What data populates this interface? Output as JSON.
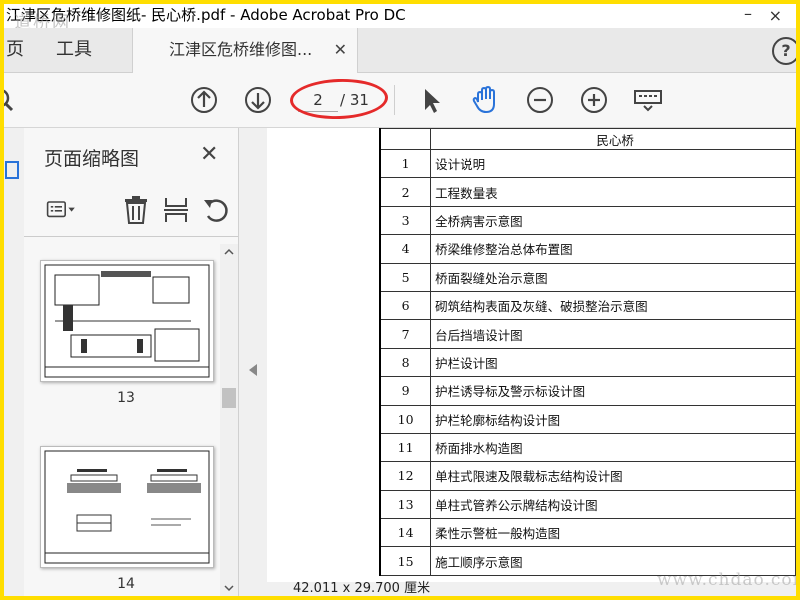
{
  "window": {
    "title": "江津区危桥维修图纸- 民心桥.pdf - Adobe Acrobat Pro DC",
    "watermark_top": "道桥网",
    "close_symbol": "×",
    "min_symbol": "–"
  },
  "tabs": {
    "home_partial": "页",
    "tools": "工具",
    "document": "江津区危桥维修图...",
    "close_symbol": "✕",
    "help_symbol": "?"
  },
  "toolbar": {
    "current_page": "2",
    "total_pages": "/ 31",
    "icons": [
      "search-icon",
      "arrow-up-circle-icon",
      "arrow-down-circle-icon",
      "select-arrow-icon",
      "hand-icon",
      "zoom-out-icon",
      "zoom-in-icon",
      "keyboard-icon"
    ],
    "hand_color": "#2a73d9"
  },
  "sidebar": {
    "title": "页面缩略图",
    "close_symbol": "✕",
    "thumbnails": [
      {
        "page": "13"
      },
      {
        "page": "14"
      }
    ]
  },
  "document": {
    "header": "民心桥",
    "rows": [
      {
        "num": "1",
        "name": "设计说明"
      },
      {
        "num": "2",
        "name": "工程数量表"
      },
      {
        "num": "3",
        "name": "全桥病害示意图"
      },
      {
        "num": "4",
        "name": "桥梁维修整治总体布置图"
      },
      {
        "num": "5",
        "name": "桥面裂缝处治示意图"
      },
      {
        "num": "6",
        "name": "砌筑结构表面及灰缝、破损整治示意图"
      },
      {
        "num": "7",
        "name": "台后挡墙设计图"
      },
      {
        "num": "8",
        "name": "护栏设计图"
      },
      {
        "num": "9",
        "name": "护栏诱导标及警示标设计图"
      },
      {
        "num": "10",
        "name": "护栏轮廓标结构设计图"
      },
      {
        "num": "11",
        "name": "桥面排水构造图"
      },
      {
        "num": "12",
        "name": "单柱式限速及限载标志结构设计图"
      },
      {
        "num": "13",
        "name": "单柱式管养公示牌结构设计图"
      },
      {
        "num": "14",
        "name": "柔性示警桩一般构造图"
      },
      {
        "num": "15",
        "name": "施工顺序示意图"
      }
    ]
  },
  "statusbar": {
    "page_size": "42.011 x 29.700 厘米"
  },
  "watermark_bottom": "www.chdao.com"
}
